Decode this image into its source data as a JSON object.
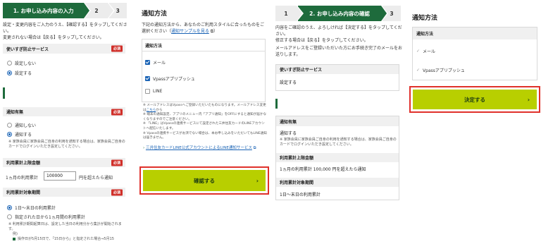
{
  "panel1": {
    "steps": [
      "1. お申し込み内容の入力",
      "2",
      "3"
    ],
    "intro": [
      "設定・変更内容をご入力のうえ、【確認する】をタップしてください。",
      "変更されない場合は【戻る】をタップしてください。"
    ],
    "overuse_title": "使いすぎ防止サービス",
    "required": "必須",
    "overuse_options": [
      "設定しない",
      "設定する"
    ],
    "notify_title": "通知有無",
    "notify_options": [
      "通知しない",
      "通知する"
    ],
    "notify_note": "家族会員に家族会員ご自身の利用を通知する場合は、家族会員ご自身のカードでログインいただき設定してください。",
    "limit_title": "利用累計上限金額",
    "limit_prefix": "1ヵ月の利用累計",
    "limit_value": "100000",
    "limit_suffix": "円を超えたら通知",
    "period_title": "利用累計対象期間",
    "period_options": [
      "1日～末日の利用累計",
      "指定された日から1ヵ月間の利用累計"
    ],
    "period_note1": "利用累計期間起算日は、設定した当日の利用分から集計が開始されます。",
    "period_note2": "例)",
    "period_note3": "操作日が5月15日で、「15日から」と指定された場合⇒5月15"
  },
  "panel2": {
    "title": "通知方法",
    "intro1": "下記の通知方法から、あなたのご利用スタイルに合ったものをご選択ください（",
    "intro_link": "通知サンプルを見る",
    "intro2": "）",
    "box_title": "通知方法",
    "options": [
      {
        "label": "メール",
        "checked": true
      },
      {
        "label": "Vpassアプリプッシュ",
        "checked": true
      },
      {
        "label": "LINE",
        "checked": false
      }
    ],
    "notes": [
      "メールアドレスはVpassへご登録いただいたものになります。メールアドレス変更は",
      "こちら",
      "から",
      "端末の通知設定、アプリのメニュー内「アプリ通知」をOFFにすると通知が届かなくなりますのでご注意ください。",
      "「LINE」はVpassの連携サービスにて設定された三井住友カードのLINEアカウントへ配信いたします。",
      "Vpassの連携サービスがお済でない場合は、本お申し込みをいただいてもLINE通知は届きません。"
    ],
    "line_link": "三井住友カードLINE公式アカウントによるLINE通知サービス",
    "confirm_button": "確認する"
  },
  "panel3": {
    "steps": [
      "1",
      "2. お申し込み内容の確認",
      "3"
    ],
    "intro": [
      "内容をご確認のうえ、よろしければ【決定する】をタップしてください。",
      "修正する場合は【戻る】をタップしてください。",
      "メールアドレスをご登録いただいた方にお手続き完了のメールをお送りします。"
    ],
    "overuse_title": "使いすぎ防止サービス",
    "overuse_value": "設定する",
    "notify_title": "通知有無",
    "notify_value": "通知する",
    "notify_note": "家族会員に家族会員ご自身の利用を通知する場合は、家族会員ご自身のカードでログインいただき設定してください。",
    "limit_title": "利用累計上限金額",
    "limit_value": "1ヵ月の利用累計 100,000 円を超えたら通知",
    "period_title": "利用累計対象期間",
    "period_value": "1日～末日の利用累計"
  },
  "panel4": {
    "title": "通知方法",
    "box_title": "通知方法",
    "options": [
      "メール",
      "Vpassアプリプッシュ"
    ],
    "decide_button": "決定する"
  },
  "colors": {
    "brand_green": "#1e6b3c",
    "button_lime": "#b8cf00",
    "highlight_red": "#e0312b",
    "link_blue": "#1a63b5"
  }
}
